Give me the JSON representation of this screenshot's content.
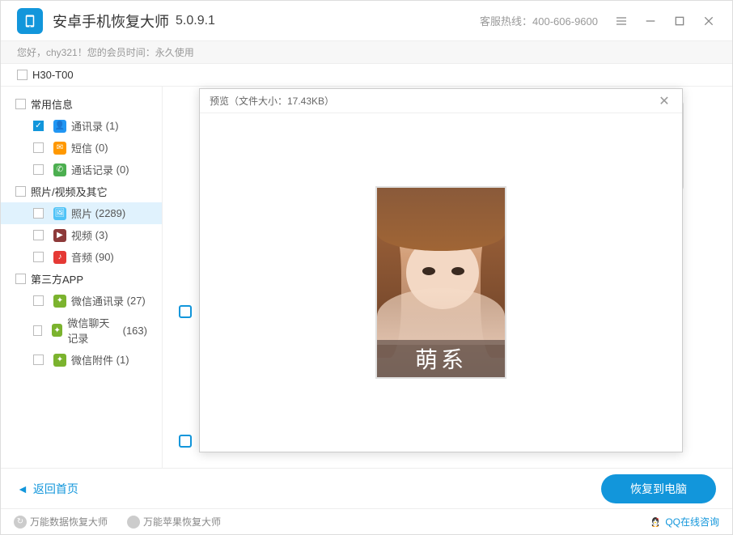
{
  "app": {
    "title": "安卓手机恢复大师",
    "version": "5.0.9.1",
    "hotline": "客服热线：400-606-9600"
  },
  "greeting": "您好，chy321！您的会员时间：永久使用",
  "device": "H30-T00",
  "tree": {
    "g1": {
      "label": "常用信息"
    },
    "g1_items": {
      "contacts": {
        "label": "通讯录",
        "count": "(1)"
      },
      "sms": {
        "label": "短信",
        "count": "(0)"
      },
      "calllog": {
        "label": "通话记录",
        "count": "(0)"
      }
    },
    "g2": {
      "label": "照片/视频及其它"
    },
    "g2_items": {
      "photos": {
        "label": "照片",
        "count": "(2289)"
      },
      "videos": {
        "label": "视频",
        "count": "(3)"
      },
      "audio": {
        "label": "音频",
        "count": "(90)"
      }
    },
    "g3": {
      "label": "第三方APP"
    },
    "g3_items": {
      "wxcontacts": {
        "label": "微信通讯录",
        "count": "(27)"
      },
      "wxchat": {
        "label": "微信聊天记录",
        "count": "(163)"
      },
      "wxattach": {
        "label": "微信附件",
        "count": "(1)"
      }
    }
  },
  "modal": {
    "title": "预览（文件大小：17.43KB）",
    "overlay_text": "萌系"
  },
  "bottom": {
    "back": "返回首页",
    "recover": "恢复到电脑"
  },
  "footer": {
    "link1": "万能数据恢复大师",
    "link2": "万能苹果恢复大师",
    "qq": "QQ在线咨询"
  }
}
